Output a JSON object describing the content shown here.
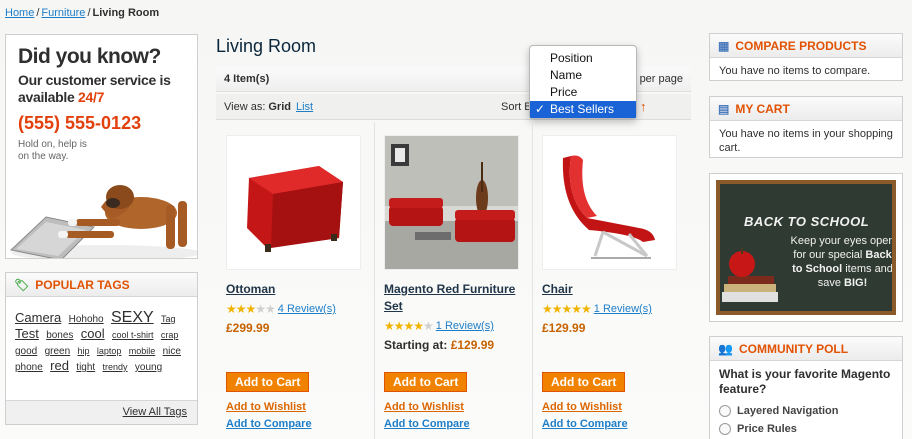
{
  "breadcrumb": {
    "home": "Home",
    "furniture": "Furniture",
    "current": "Living Room",
    "sep": "/"
  },
  "promo": {
    "heading": "Did you know?",
    "line1": "Our customer service is available ",
    "accent": "24/7",
    "phone": "(555) 555-0123",
    "hold": "Hold on, help is on the way."
  },
  "tags": {
    "title": "Popular Tags",
    "items": [
      {
        "label": "Camera",
        "size": 13
      },
      {
        "label": "Hohoho",
        "size": 10
      },
      {
        "label": "SEXY",
        "size": 16
      },
      {
        "label": "Tag",
        "size": 9
      },
      {
        "label": "Test",
        "size": 13
      },
      {
        "label": "bones",
        "size": 10
      },
      {
        "label": "cool",
        "size": 13
      },
      {
        "label": "cool t-shirt",
        "size": 9
      },
      {
        "label": "crap",
        "size": 9
      },
      {
        "label": "good",
        "size": 10
      },
      {
        "label": "green",
        "size": 10
      },
      {
        "label": "hip",
        "size": 9
      },
      {
        "label": "laptop",
        "size": 9
      },
      {
        "label": "mobile",
        "size": 9
      },
      {
        "label": "nice",
        "size": 10
      },
      {
        "label": "phone",
        "size": 10
      },
      {
        "label": "red",
        "size": 13
      },
      {
        "label": "tight",
        "size": 10
      },
      {
        "label": "trendy",
        "size": 9
      },
      {
        "label": "young",
        "size": 10
      }
    ],
    "view_all": "View All Tags"
  },
  "main": {
    "title": "Living Room",
    "count": "4 Item(s)",
    "per_page": "per page",
    "view_as": "View as:",
    "grid": "Grid",
    "list": "List",
    "sort_by": "Sort By",
    "arrow": "↑",
    "sort_options": [
      "Position",
      "Name",
      "Price",
      "Best Sellers"
    ],
    "sort_selected": "Best Sellers",
    "check": "✓"
  },
  "products": [
    {
      "name": "Ottoman",
      "stars": 3,
      "reviews": "4 Review(s)",
      "price": "£299.99",
      "starting": ""
    },
    {
      "name": "Magento Red Furniture Set",
      "stars": 4,
      "reviews": "1 Review(s)",
      "price": "£129.99",
      "starting": "Starting at:"
    },
    {
      "name": "Chair",
      "stars": 5,
      "reviews": "1 Review(s)",
      "price": "£129.99",
      "starting": ""
    }
  ],
  "buttons": {
    "add_to_cart": "Add to Cart",
    "wishlist": "Add to Wishlist",
    "compare": "Add to Compare"
  },
  "compare": {
    "title": "Compare Products",
    "text": "You have no items to compare."
  },
  "cart": {
    "title": "My Cart",
    "text": "You have no items in your shopping cart."
  },
  "school": {
    "title": "BACK TO SCHOOL",
    "t1": "Keep your eyes open for our special ",
    "b1": "Back to School",
    "t2": " items and save ",
    "b2": "BIG!"
  },
  "poll": {
    "title": "Community Poll",
    "question": "What is your favorite Magento feature?",
    "options": [
      "Layered Navigation",
      "Price Rules"
    ]
  },
  "colors": {
    "accent": "#e25203",
    "link": "#1e7ec8",
    "button": "#f18200",
    "price": "#c76200"
  }
}
